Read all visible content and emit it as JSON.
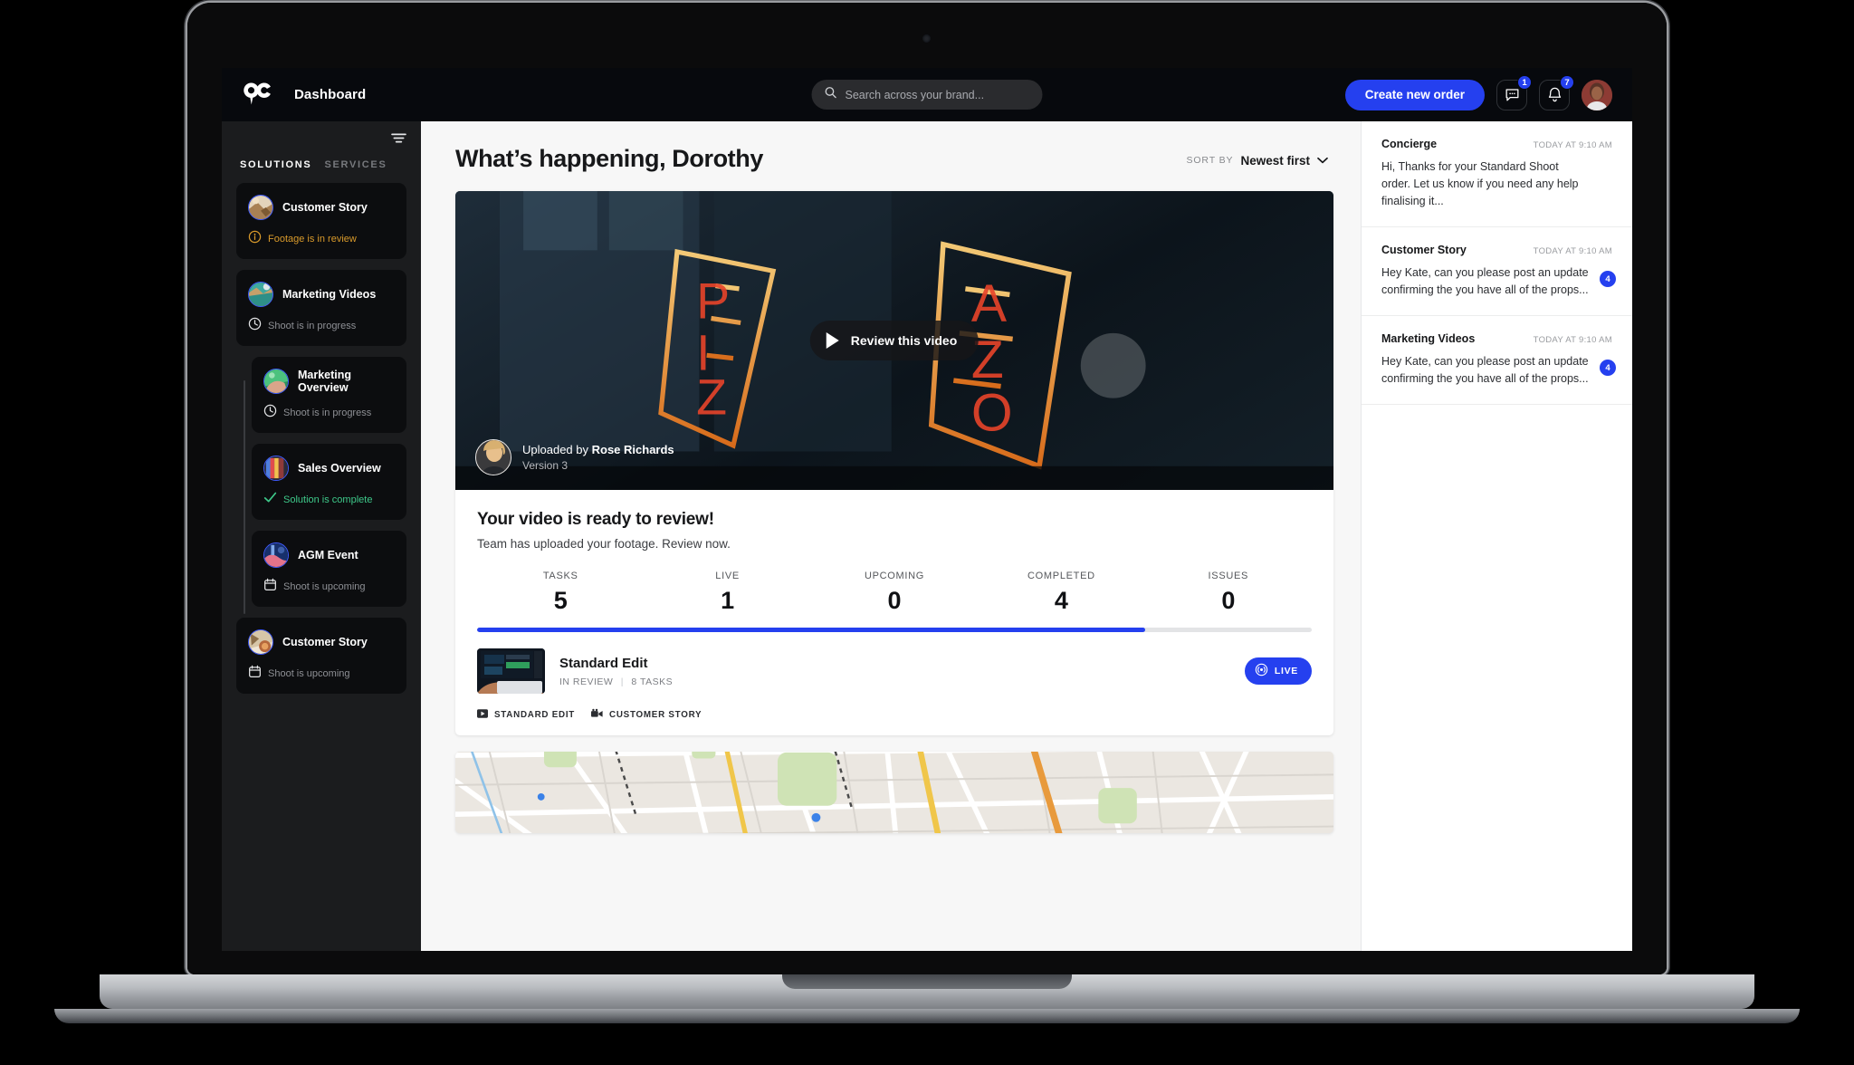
{
  "topbar": {
    "logo_icon": "ninety-logo-icon",
    "title": "Dashboard",
    "search": {
      "placeholder": "Search across your brand...",
      "value": "",
      "icon": "search-icon"
    },
    "cta_label": "Create new order",
    "messages": {
      "icon": "chat-bubble-icon",
      "badge": "1"
    },
    "notifications": {
      "icon": "bell-icon",
      "badge": "7"
    },
    "avatar": "user-avatar"
  },
  "sidebar": {
    "filter_icon": "filter-icon",
    "tabs": [
      {
        "label": "SOLUTIONS",
        "active": true
      },
      {
        "label": "SERVICES",
        "active": false
      }
    ],
    "items": [
      {
        "title": "Customer Story",
        "status": "Footage is in review",
        "status_kind": "warn",
        "status_icon": "info-circle-icon",
        "indent": false
      },
      {
        "title": "Marketing Videos",
        "status": "Shoot is in progress",
        "status_kind": "grey",
        "status_icon": "clock-icon",
        "indent": false
      },
      {
        "title": "Marketing Overview",
        "status": "Shoot is in progress",
        "status_kind": "grey",
        "status_icon": "clock-icon",
        "indent": true
      },
      {
        "title": "Sales Overview",
        "status": "Solution is complete",
        "status_kind": "green",
        "status_icon": "check-icon",
        "indent": true
      },
      {
        "title": "AGM Event",
        "status": "Shoot is upcoming",
        "status_kind": "grey",
        "status_icon": "calendar-icon",
        "indent": true
      },
      {
        "title": "Customer Story",
        "status": "Shoot is upcoming",
        "status_kind": "grey",
        "status_icon": "calendar-icon",
        "indent": false
      }
    ]
  },
  "main": {
    "page_title": "What’s happening, Dorothy",
    "sort": {
      "label": "SORT BY",
      "value": "Newest first",
      "icon": "chevron-down-icon"
    },
    "video": {
      "play_label": "Review this video",
      "play_icon": "play-icon",
      "uploaded_prefix": "Uploaded by ",
      "uploader": "Rose Richards",
      "version": "Version 3"
    },
    "card": {
      "title": "Your video is ready to review!",
      "subtitle": "Team has uploaded your footage. Review now."
    },
    "stats": [
      {
        "label": "TASKS",
        "value": "5"
      },
      {
        "label": "LIVE",
        "value": "1"
      },
      {
        "label": "UPCOMING",
        "value": "0"
      },
      {
        "label": "COMPLETED",
        "value": "4"
      },
      {
        "label": "ISSUES",
        "value": "0"
      }
    ],
    "progress_percent": 80,
    "task": {
      "title": "Standard Edit",
      "status": "IN REVIEW",
      "tasks": "8 TASKS",
      "live_label": "LIVE",
      "live_icon": "broadcast-icon"
    },
    "chips": [
      {
        "label": "STANDARD EDIT",
        "icon": "video-play-icon"
      },
      {
        "label": "CUSTOMER STORY",
        "icon": "movie-camera-icon"
      }
    ]
  },
  "rightrail": {
    "notifications": [
      {
        "title": "Concierge",
        "time": "TODAY AT 9:10 AM",
        "text": "Hi, Thanks for your Standard Shoot order. Let us know if you need any help finalising it...",
        "badge": ""
      },
      {
        "title": "Customer Story",
        "time": "TODAY AT 9:10 AM",
        "text": "Hey Kate, can you please post an update confirming the you have all of the props...",
        "badge": "4"
      },
      {
        "title": "Marketing Videos",
        "time": "TODAY AT 9:10 AM",
        "text": "Hey Kate, can you please post an update confirming the you have all of the props...",
        "badge": "4"
      }
    ]
  },
  "colors": {
    "accent": "#2540ef",
    "warn": "#d99a2b",
    "success": "#3ec98a",
    "topbar_bg": "#07090d",
    "sidebar_bg": "#1b1c1e",
    "main_bg": "#f7f7f7"
  }
}
